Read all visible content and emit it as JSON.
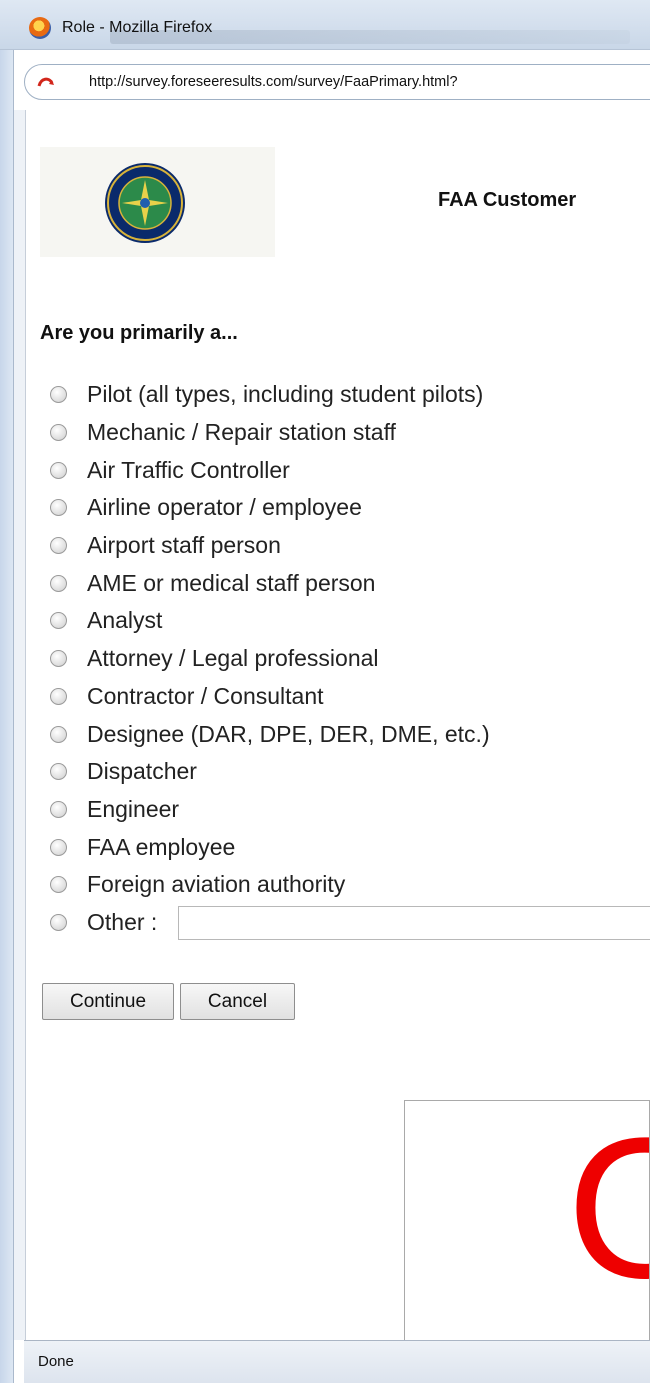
{
  "window": {
    "title": "Role - Mozilla Firefox"
  },
  "browser": {
    "url": "http://survey.foreseeresults.com/survey/FaaPrimary.html?"
  },
  "page": {
    "header_title": "FAA Customer",
    "logo_icon": "faa-seal-icon",
    "question": "Are you primarily a...",
    "options": [
      "Pilot (all types, including student pilots)",
      "Mechanic / Repair station staff",
      "Air Traffic Controller",
      "Airline operator / employee",
      "Airport staff person",
      "AME or medical staff person",
      "Analyst",
      "Attorney / Legal professional",
      "Contractor / Consultant",
      "Designee (DAR, DPE, DER, DME, etc.)",
      "Dispatcher",
      "Engineer",
      "FAA employee",
      "Foreign aviation authority",
      "Other :"
    ],
    "other_value": "",
    "buttons": {
      "continue": "Continue",
      "cancel": "Cancel"
    },
    "overlay_letter": "O"
  },
  "status": {
    "text": "Done"
  },
  "colors": {
    "accent_red": "#ee0000",
    "chrome_blue": "#c9d7e8"
  }
}
